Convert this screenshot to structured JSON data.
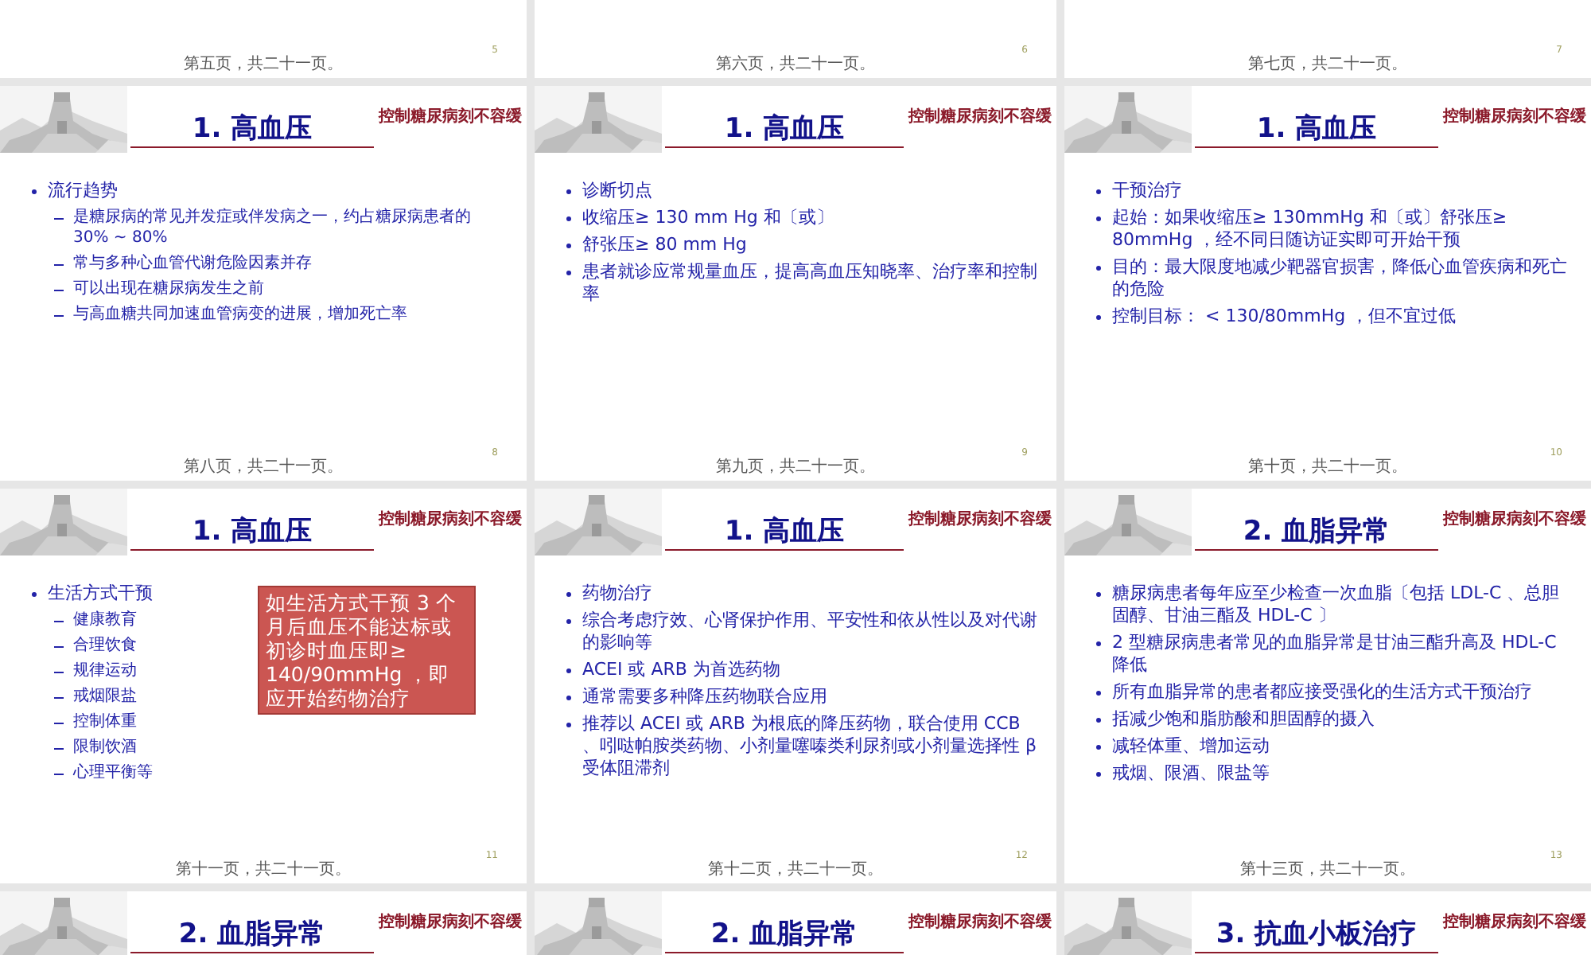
{
  "slides": [
    {
      "number": "5",
      "footer": "第五页，共二十一页。"
    },
    {
      "number": "6",
      "footer": "第六页，共二十一页。"
    },
    {
      "number": "7",
      "footer": "第七页，共二十一页。"
    },
    {
      "number": "8",
      "footer": "第八页，共二十一页。",
      "title": "1. 高血压",
      "logo": {
        "text": "控制糖尿病刻不容缓"
      },
      "bullets": [
        {
          "text": "流行趋势",
          "children": [
            {
              "text": "是糖尿病的常见并发症或伴发病之一，约占糖尿病患者的 30% ~ 80%"
            },
            {
              "text": "常与多种心血管代谢危险因素并存"
            },
            {
              "text": "可以出现在糖尿病发生之前"
            },
            {
              "text": "与高血糖共同加速血管病变的进展，增加死亡率"
            }
          ]
        }
      ]
    },
    {
      "number": "9",
      "footer": "第九页，共二十一页。",
      "title": "1. 高血压",
      "logo": {
        "text": "控制糖尿病刻不容缓"
      },
      "bullets": [
        {
          "text": "诊断切点"
        },
        {
          "text": "收缩压≥ 130 mm Hg 和〔或〕"
        },
        {
          "text": "舒张压≥ 80 mm Hg"
        },
        {
          "text": "患者就诊应常规量血压，提高高血压知晓率、治疗率和控制率"
        }
      ]
    },
    {
      "number": "10",
      "footer": "第十页，共二十一页。",
      "title": "1. 高血压",
      "logo": {
        "text": "控制糖尿病刻不容缓"
      },
      "bullets": [
        {
          "text": "干预治疗"
        },
        {
          "text": "起始：如果收缩压≥ 130mmHg 和〔或〕舒张压≥ 80mmHg ，经不同日随访证实即可开始干预"
        },
        {
          "text": "目的：最大限度地减少靶器官损害，降低心血管疾病和死亡的危险"
        },
        {
          "text": "控制目标： < 130/80mmHg ，但不宜过低"
        }
      ]
    },
    {
      "number": "11",
      "footer": "第十一页，共二十一页。",
      "title": "1. 高血压",
      "logo": {
        "text": "控制糖尿病刻不容缓"
      },
      "bullets": [
        {
          "text": "生活方式干预",
          "children": [
            {
              "text": "健康教育"
            },
            {
              "text": "合理饮食"
            },
            {
              "text": "规律运动"
            },
            {
              "text": "戒烟限盐"
            },
            {
              "text": "控制体重"
            },
            {
              "text": "限制饮酒"
            },
            {
              "text": "心理平衡等"
            }
          ]
        }
      ],
      "callout": "如生活方式干预 3 个月后血压不能达标或初诊时血压即≥ 140/90mmHg ，即应开始药物治疗"
    },
    {
      "number": "12",
      "footer": "第十二页，共二十一页。",
      "title": "1. 高血压",
      "logo": {
        "text": "控制糖尿病刻不容缓"
      },
      "bullets": [
        {
          "text": "药物治疗"
        },
        {
          "text": "综合考虑疗效、心肾保护作用、平安性和依从性以及对代谢的影响等"
        },
        {
          "text": "ACEI 或 ARB 为首选药物"
        },
        {
          "text": "通常需要多种降压药物联合应用"
        },
        {
          "text": "推荐以 ACEI 或 ARB 为根底的降压药物，联合使用 CCB 、吲哒帕胺类药物、小剂量噻嗪类利尿剂或小剂量选择性 β 受体阻滞剂"
        }
      ]
    },
    {
      "number": "13",
      "footer": "第十三页，共二十一页。",
      "title": "2. 血脂异常",
      "logo": {
        "text": "控制糖尿病刻不容缓"
      },
      "bullets": [
        {
          "text": "糖尿病患者每年应至少检查一次血脂〔包括 LDL-C 、总胆固醇、甘油三酯及 HDL-C 〕"
        },
        {
          "text": "2 型糖尿病患者常见的血脂异常是甘油三酯升高及 HDL-C 降低"
        },
        {
          "text": "所有血脂异常的患者都应接受强化的生活方式干预治疗"
        },
        {
          "text": "括减少饱和脂肪酸和胆固醇的摄入"
        },
        {
          "text": "减轻体重、增加运动"
        },
        {
          "text": "戒烟、限酒、限盐等"
        }
      ]
    },
    {
      "title": "2. 血脂异常",
      "logo": {
        "text": "控制糖尿病刻不容缓"
      }
    },
    {
      "title": "2. 血脂异常",
      "logo": {
        "text": "控制糖尿病刻不容缓"
      }
    },
    {
      "title": "3. 抗血小板治疗",
      "logo": {
        "text": "控制糖尿病刻不容缓"
      }
    }
  ]
}
